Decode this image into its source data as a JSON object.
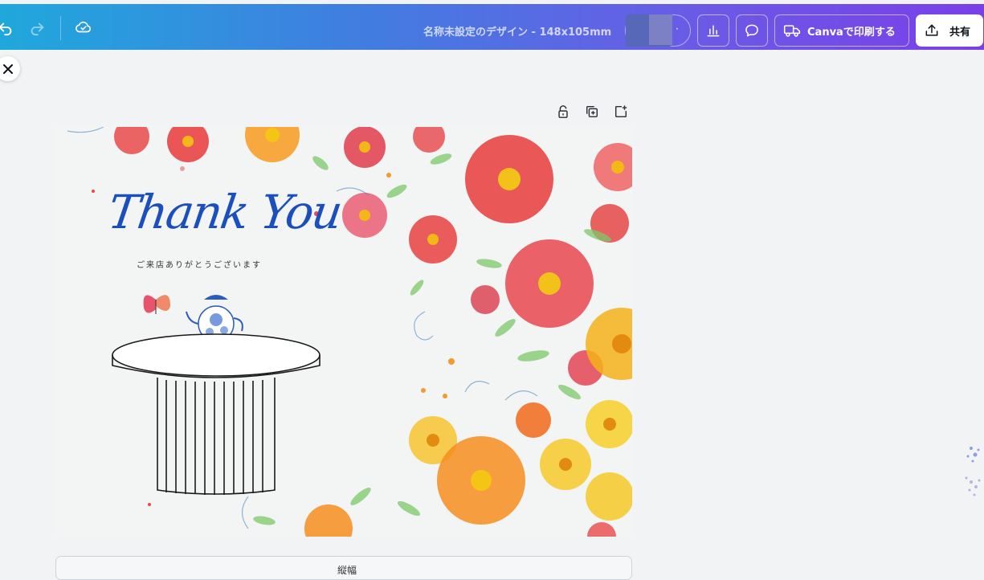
{
  "toolbar": {
    "doc_title": "名称未設定のデザイン - 148x105mm",
    "print_label": "Canvaで印刷する",
    "share_label": "共有",
    "avatar_more": "·"
  },
  "canvas": {
    "heading": "Thank You",
    "subtext": "ご来店ありがとうございます"
  },
  "bottom_panel": {
    "label": "縦幅"
  },
  "colors": {
    "gradient_start": "#20a8dc",
    "gradient_end": "#7a3fe8",
    "heading_blue": "#1a4fbd",
    "canvas_bg": "#f3f4f4"
  },
  "icons": {
    "undo": "undo-icon",
    "redo": "redo-icon",
    "cloud_saved": "cloud-check-icon",
    "insights": "bar-chart-icon",
    "comment": "comment-icon",
    "print": "truck-icon",
    "share": "upload-icon",
    "close": "close-icon",
    "lock": "lock-icon",
    "duplicate": "duplicate-icon",
    "add_page": "add-page-icon"
  }
}
